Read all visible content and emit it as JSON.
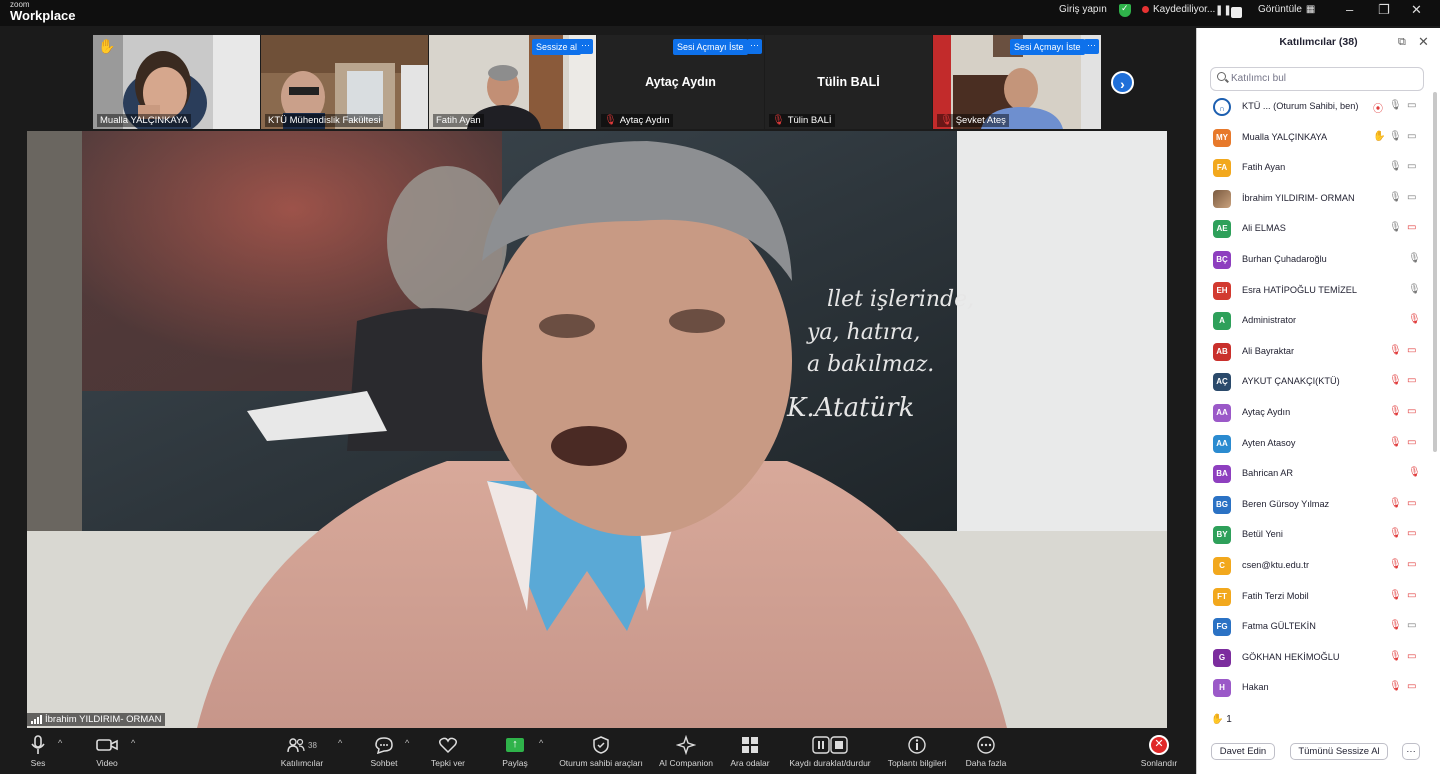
{
  "titlebar": {
    "brand_small": "zoom",
    "brand_big": "Workplace",
    "signin": "Giriş yapın",
    "recording": "Kaydediliyor...",
    "view": "Görüntüle"
  },
  "thumbnails": [
    {
      "name": "Mualla YALÇINKAYA"
    },
    {
      "name": "KTÜ Mühendislik Fakültesi"
    },
    {
      "name": "Fatih Ayan",
      "tag": "Sessize al"
    },
    {
      "name": "Aytaç Aydın",
      "label": "Aytaç Aydın",
      "tag": "Sesi Açmayı İste"
    },
    {
      "name": "Tülin BALİ",
      "label": "Tülin BALİ"
    },
    {
      "name": "Şevket Ateş",
      "tag": "Sesi Açmayı İste"
    }
  ],
  "more_glyph": "···",
  "main_speaker": "İbrahim YILDIRIM- ORMAN",
  "toolbar": {
    "audio": "Ses",
    "video": "Video",
    "participants": "Katılımcılar",
    "participants_count": "38",
    "chat": "Sohbet",
    "react": "Tepki ver",
    "share": "Paylaş",
    "host_tools": "Oturum sahibi araçları",
    "ai": "AI Companion",
    "breakout": "Ara odalar",
    "record": "Kaydı duraklat/durdur",
    "info": "Toplantı bilgileri",
    "more": "Daha fazla",
    "end": "Sonlandır"
  },
  "panel": {
    "title": "Katılımcılar (38)",
    "search_placeholder": "Katılımcı bul",
    "hand_count": "1",
    "invite": "Davet Edin",
    "mute_all": "Tümünü Sessize Al",
    "more": "···"
  },
  "participants": [
    {
      "initials": "",
      "name": "KTÜ ...  (Oturum Sahibi, ben)",
      "color": "#1d5fb0",
      "mic": "on",
      "video": "on",
      "rec": true,
      "logo": true
    },
    {
      "initials": "MY",
      "name": "Mualla YALÇINKAYA",
      "color": "#e7792b",
      "mic": "on",
      "video": "on",
      "hand": true
    },
    {
      "initials": "FA",
      "name": "Fatih Ayan",
      "color": "#f2a81d",
      "mic": "on",
      "video": "on"
    },
    {
      "initials": "",
      "name": "İbrahim YILDIRIM- ORMAN",
      "color": "#8a6a4a",
      "mic": "on",
      "video": "on",
      "photo": true
    },
    {
      "initials": "AE",
      "name": "Ali ELMAS",
      "color": "#2ea05a",
      "mic": "on",
      "video": "off"
    },
    {
      "initials": "BÇ",
      "name": "Burhan Çuhadaroğlu",
      "color": "#8e3fbf",
      "mic": "on",
      "video": "none"
    },
    {
      "initials": "EH",
      "name": "Esra HATİPOĞLU TEMİZEL",
      "color": "#d23a30",
      "mic": "on",
      "video": "none"
    },
    {
      "initials": "A",
      "name": "Administrator",
      "color": "#2ea05a",
      "mic": "off",
      "video": "none"
    },
    {
      "initials": "AB",
      "name": "Ali Bayraktar",
      "color": "#c9302c",
      "mic": "off",
      "video": "off"
    },
    {
      "initials": "AÇ",
      "name": "AYKUT ÇANAKÇI(KTÜ)",
      "color": "#2b4a6b",
      "mic": "off",
      "video": "off"
    },
    {
      "initials": "AA",
      "name": "Aytaç Aydın",
      "color": "#9b59c8",
      "mic": "off",
      "video": "off"
    },
    {
      "initials": "AA",
      "name": "Ayten Atasoy",
      "color": "#2b8bd0",
      "mic": "off",
      "video": "off"
    },
    {
      "initials": "BA",
      "name": "Bahrican AR",
      "color": "#8e3fbf",
      "mic": "off",
      "video": "none"
    },
    {
      "initials": "BG",
      "name": "Beren Gürsoy Yılmaz",
      "color": "#2b72c4",
      "mic": "off",
      "video": "off"
    },
    {
      "initials": "BY",
      "name": "Betül Yeni",
      "color": "#2ea05a",
      "mic": "off",
      "video": "off"
    },
    {
      "initials": "C",
      "name": "csen@ktu.edu.tr",
      "color": "#f2a81d",
      "mic": "off",
      "video": "off"
    },
    {
      "initials": "FT",
      "name": "Fatih Terzi Mobil",
      "color": "#f2a81d",
      "mic": "off",
      "video": "off"
    },
    {
      "initials": "FG",
      "name": "Fatma GÜLTEKİN",
      "color": "#2b72c4",
      "mic": "off",
      "video": "on"
    },
    {
      "initials": "G",
      "name": "GÖKHAN HEKİMOĞLU",
      "color": "#7c2d9e",
      "mic": "off",
      "video": "off"
    },
    {
      "initials": "H",
      "name": "Hakan",
      "color": "#9b59c8",
      "mic": "off",
      "video": "off"
    }
  ]
}
